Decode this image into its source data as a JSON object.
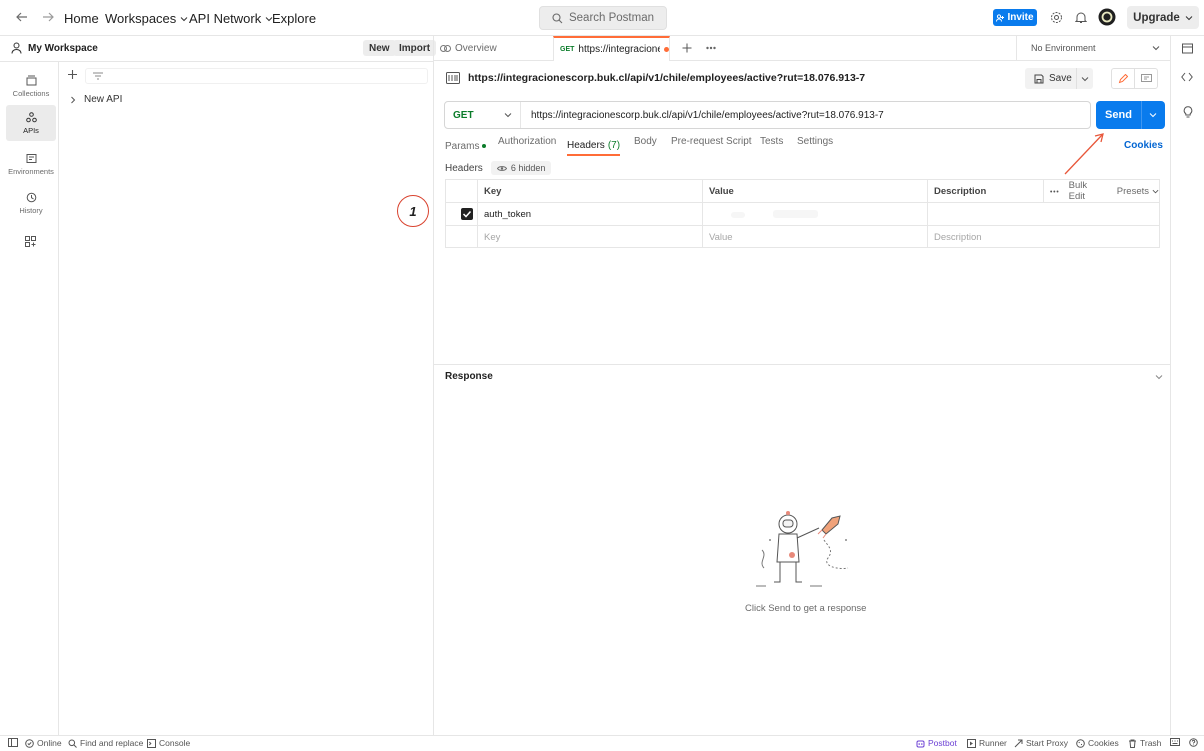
{
  "topbar": {
    "home": "Home",
    "workspaces": "Workspaces",
    "api_network": "API Network",
    "explore": "Explore",
    "search_placeholder": "Search Postman",
    "invite": "Invite",
    "upgrade": "Upgrade"
  },
  "workspace": {
    "name": "My Workspace",
    "new_label": "New",
    "import_label": "Import",
    "tree_item": "New API"
  },
  "leftnav": {
    "collections": "Collections",
    "apis": "APIs",
    "environments": "Environments",
    "history": "History"
  },
  "tabs": {
    "overview": "Overview",
    "request_method": "GET",
    "request_label": "https://integracionescc"
  },
  "environment": {
    "selected": "No Environment"
  },
  "request": {
    "title": "https://integracionescorp.buk.cl/api/v1/chile/employees/active?rut=18.076.913-7",
    "save_label": "Save",
    "method": "GET",
    "url": "https://integracionescorp.buk.cl/api/v1/chile/employees/active?rut=18.076.913-7",
    "send_label": "Send"
  },
  "subtabs": {
    "params": "Params",
    "authorization": "Authorization",
    "headers": "Headers",
    "headers_count": "(7)",
    "body": "Body",
    "prerequest": "Pre-request Script",
    "tests": "Tests",
    "settings": "Settings",
    "cookies": "Cookies"
  },
  "headers_section": {
    "label": "Headers",
    "hidden": "6 hidden",
    "col_key": "Key",
    "col_value": "Value",
    "col_description": "Description",
    "bulk_edit": "Bulk Edit",
    "presets": "Presets",
    "rows": [
      {
        "key": "auth_token",
        "value": "",
        "description": "",
        "checked": true
      }
    ],
    "placeholder_key": "Key",
    "placeholder_value": "Value",
    "placeholder_description": "Description"
  },
  "annotation": {
    "marker": "1"
  },
  "response": {
    "label": "Response",
    "hint": "Click Send to get a response"
  },
  "statusbar": {
    "online": "Online",
    "find_replace": "Find and replace",
    "console": "Console",
    "postbot": "Postbot",
    "runner": "Runner",
    "start_proxy": "Start Proxy",
    "cookies": "Cookies",
    "trash": "Trash"
  },
  "colors": {
    "accent_orange": "#ff6c37",
    "send_blue": "#097bed",
    "get_green": "#0b7c2a",
    "link_blue": "#0265d2"
  }
}
